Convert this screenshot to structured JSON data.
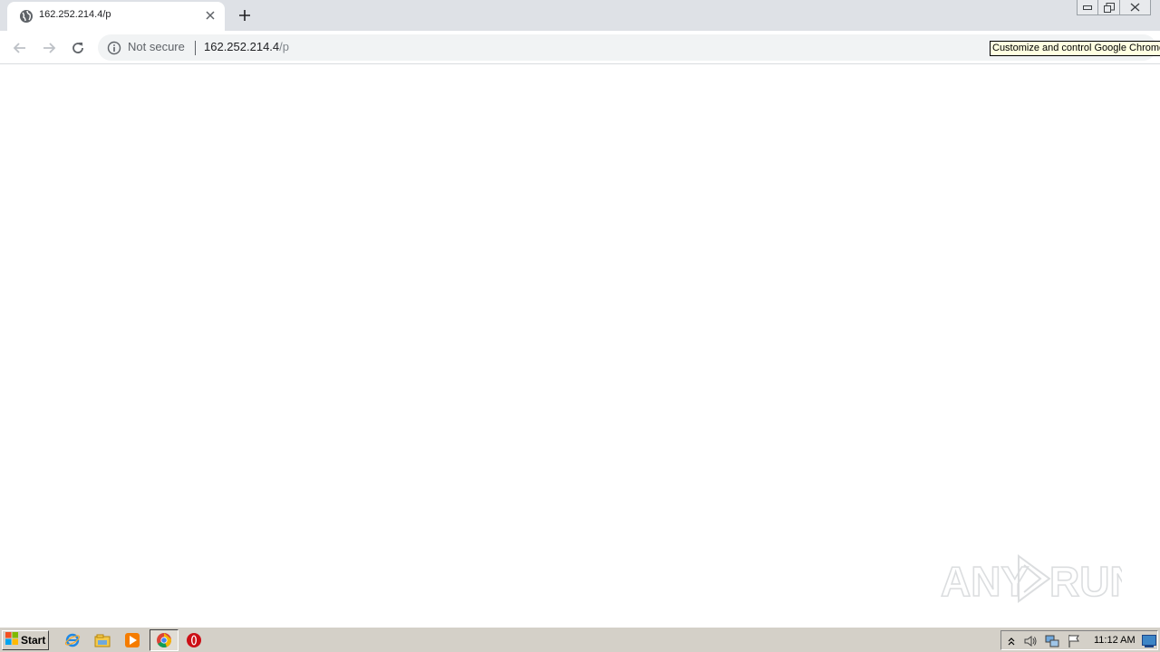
{
  "browser": {
    "tab": {
      "title": "162.252.214.4/p",
      "favicon": "globe-icon"
    },
    "new_tab_icon": "plus-icon",
    "omnibox": {
      "security_label": "Not secure",
      "url_host": "162.252.214.4",
      "url_path": "/p"
    },
    "tooltip": "Customize and control Google Chrome"
  },
  "watermark": {
    "text_left": "ANY",
    "text_right": "RUN"
  },
  "taskbar": {
    "start_label": "Start",
    "pinned": [
      "ie-icon",
      "explorer-icon",
      "media-player-icon",
      "chrome-icon",
      "opera-icon"
    ],
    "clock": "11:12 AM"
  },
  "colors": {
    "tabstrip": "#dee1e6",
    "omnibox": "#f1f3f4",
    "taskbar": "#d4d0c8",
    "tooltip": "#ffffe1"
  }
}
